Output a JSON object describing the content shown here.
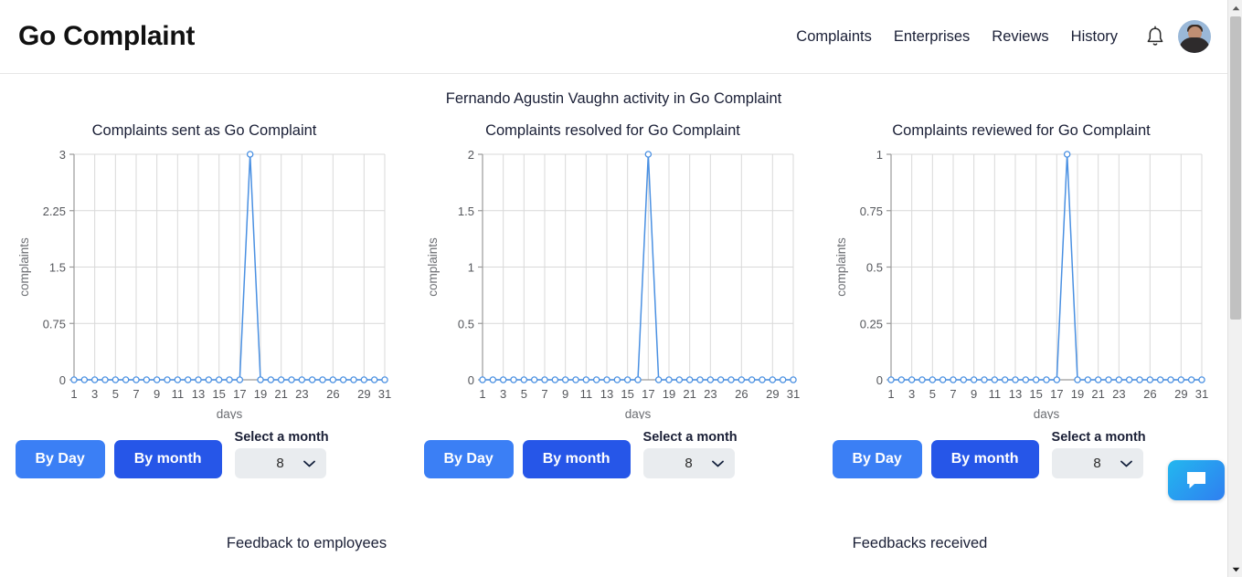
{
  "header": {
    "brand": "Go Complaint",
    "nav": [
      {
        "label": "Complaints",
        "name": "nav-complaints"
      },
      {
        "label": "Enterprises",
        "name": "nav-enterprises"
      },
      {
        "label": "Reviews",
        "name": "nav-reviews"
      },
      {
        "label": "History",
        "name": "nav-history"
      }
    ],
    "bell_icon": "bell-icon",
    "avatar_icon": "user-avatar"
  },
  "main": {
    "subtitle": "Fernando Agustin Vaughn activity in Go Complaint"
  },
  "controls": {
    "by_day_label": "By Day",
    "by_month_label": "By month",
    "select_label": "Select a month",
    "select_value": "8",
    "chevron_icon": "chevron-down-icon"
  },
  "bottom": {
    "left_title": "Feedback to employees",
    "right_title": "Feedbacks received"
  },
  "chat": {
    "icon": "chat-bubble-icon"
  },
  "scrollbar": {
    "up_icon": "scroll-up-arrow",
    "down_icon": "scroll-down-arrow"
  },
  "colors": {
    "accent_line": "#4a90e2",
    "btn_day": "#3b7ff5",
    "btn_month": "#2656e8",
    "chat_gradient_start": "#23b7ef",
    "chat_gradient_end": "#2f7ff0",
    "text": "#1a1f36"
  },
  "chart_data": [
    {
      "type": "line",
      "title": "Complaints sent as Go Complaint",
      "xlabel": "days",
      "ylabel": "complaints",
      "ylim": [
        0,
        3
      ],
      "yticks": [
        "0",
        "0.75",
        "1.5",
        "2.25",
        "3"
      ],
      "ytick_values": [
        0,
        0.75,
        1.5,
        2.25,
        3
      ],
      "xticks": [
        "1",
        "3",
        "5",
        "7",
        "9",
        "11",
        "13",
        "15",
        "17",
        "19",
        "21",
        "23",
        "26",
        "29",
        "31"
      ],
      "xtick_values": [
        1,
        3,
        5,
        7,
        9,
        11,
        13,
        15,
        17,
        19,
        21,
        23,
        26,
        29,
        31
      ],
      "x": [
        1,
        2,
        3,
        4,
        5,
        6,
        7,
        8,
        9,
        10,
        11,
        12,
        13,
        14,
        15,
        16,
        17,
        18,
        19,
        20,
        21,
        22,
        23,
        24,
        25,
        26,
        27,
        28,
        29,
        30,
        31
      ],
      "values": [
        0,
        0,
        0,
        0,
        0,
        0,
        0,
        0,
        0,
        0,
        0,
        0,
        0,
        0,
        0,
        0,
        0,
        3,
        0,
        0,
        0,
        0,
        0,
        0,
        0,
        0,
        0,
        0,
        0,
        0,
        0
      ],
      "grid": true,
      "legend": "none",
      "markers": true
    },
    {
      "type": "line",
      "title": "Complaints resolved for Go Complaint",
      "xlabel": "days",
      "ylabel": "complaints",
      "ylim": [
        0,
        2
      ],
      "yticks": [
        "0",
        "0.5",
        "1",
        "1.5",
        "2"
      ],
      "ytick_values": [
        0,
        0.5,
        1,
        1.5,
        2
      ],
      "xticks": [
        "1",
        "3",
        "5",
        "7",
        "9",
        "11",
        "13",
        "15",
        "17",
        "19",
        "21",
        "23",
        "26",
        "29",
        "31"
      ],
      "xtick_values": [
        1,
        3,
        5,
        7,
        9,
        11,
        13,
        15,
        17,
        19,
        21,
        23,
        26,
        29,
        31
      ],
      "x": [
        1,
        2,
        3,
        4,
        5,
        6,
        7,
        8,
        9,
        10,
        11,
        12,
        13,
        14,
        15,
        16,
        17,
        18,
        19,
        20,
        21,
        22,
        23,
        24,
        25,
        26,
        27,
        28,
        29,
        30,
        31
      ],
      "values": [
        0,
        0,
        0,
        0,
        0,
        0,
        0,
        0,
        0,
        0,
        0,
        0,
        0,
        0,
        0,
        0,
        2,
        0,
        0,
        0,
        0,
        0,
        0,
        0,
        0,
        0,
        0,
        0,
        0,
        0,
        0
      ],
      "grid": true,
      "legend": "none",
      "markers": true
    },
    {
      "type": "line",
      "title": "Complaints reviewed for Go Complaint",
      "xlabel": "days",
      "ylabel": "complaints",
      "ylim": [
        0,
        1
      ],
      "yticks": [
        "0",
        "0.25",
        "0.5",
        "0.75",
        "1"
      ],
      "ytick_values": [
        0,
        0.25,
        0.5,
        0.75,
        1
      ],
      "xticks": [
        "1",
        "3",
        "5",
        "7",
        "9",
        "11",
        "13",
        "15",
        "17",
        "19",
        "21",
        "23",
        "26",
        "29",
        "31"
      ],
      "xtick_values": [
        1,
        3,
        5,
        7,
        9,
        11,
        13,
        15,
        17,
        19,
        21,
        23,
        26,
        29,
        31
      ],
      "x": [
        1,
        2,
        3,
        4,
        5,
        6,
        7,
        8,
        9,
        10,
        11,
        12,
        13,
        14,
        15,
        16,
        17,
        18,
        19,
        20,
        21,
        22,
        23,
        24,
        25,
        26,
        27,
        28,
        29,
        30,
        31
      ],
      "values": [
        0,
        0,
        0,
        0,
        0,
        0,
        0,
        0,
        0,
        0,
        0,
        0,
        0,
        0,
        0,
        0,
        0,
        1,
        0,
        0,
        0,
        0,
        0,
        0,
        0,
        0,
        0,
        0,
        0,
        0,
        0
      ],
      "grid": true,
      "legend": "none",
      "markers": true
    }
  ]
}
